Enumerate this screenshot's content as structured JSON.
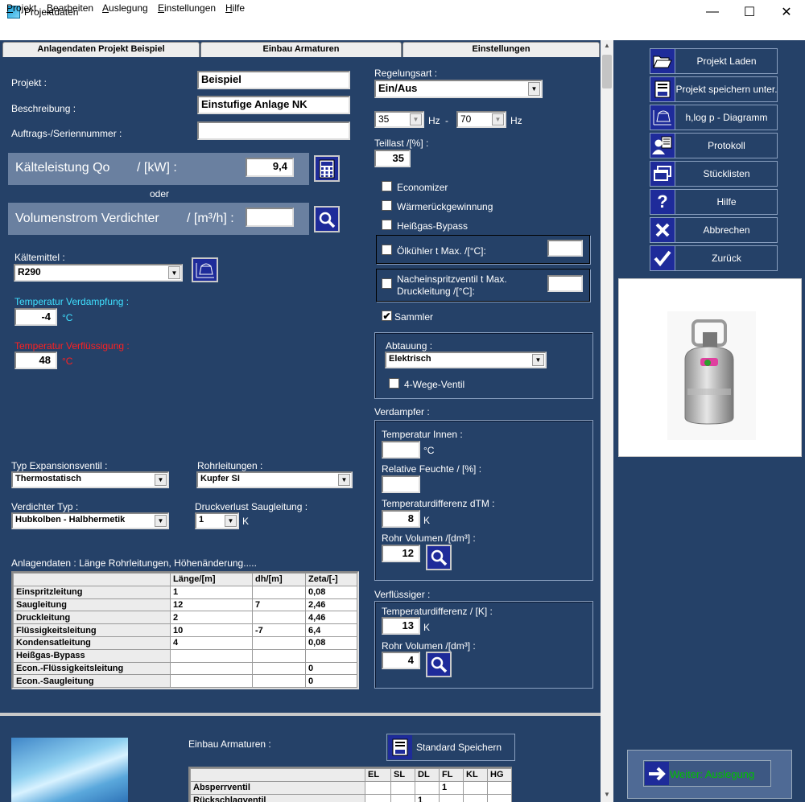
{
  "window": {
    "title": "Projektdaten",
    "minimize": "—",
    "maximize": "☐",
    "close": "✕"
  },
  "menu": [
    {
      "pre": "",
      "u": "P",
      "post": "rojekt"
    },
    {
      "pre": "",
      "u": "B",
      "post": "earbeiten"
    },
    {
      "pre": "",
      "u": "A",
      "post": "uslegung"
    },
    {
      "pre": "",
      "u": "E",
      "post": "instellungen"
    },
    {
      "pre": "",
      "u": "H",
      "post": "ilfe"
    }
  ],
  "tabs": [
    "Anlagendaten Projekt Beispiel",
    "Einbau Armaturen",
    "Einstellungen"
  ],
  "project": {
    "projekt_label": "Projekt :",
    "projekt_value": "Beispiel",
    "beschreibung_label": "Beschreibung :",
    "beschreibung_value": "Einstufige Anlage NK",
    "auftrag_label": "Auftrags-/Seriennummer :",
    "auftrag_value": ""
  },
  "capacity": {
    "label": "Kälteleistung Qo",
    "unit": "/ [kW] :",
    "value": "9,4",
    "oder": "oder",
    "vol_label": "Volumenstrom Verdichter",
    "vol_unit": "/ [m³/h] :",
    "vol_value": ""
  },
  "refrigerant": {
    "label": "Kältemittel :",
    "value": "R290"
  },
  "temps": {
    "evap_label": "Temperatur Verdampfung :",
    "evap_value": "-4",
    "evap_unit": "°C",
    "cond_label": "Temperatur Verflüssigung :",
    "cond_value": "48",
    "cond_unit": "°C"
  },
  "expansion": {
    "label": "Typ Expansionsventil :",
    "value": "Thermostatisch"
  },
  "pipes": {
    "label": "Rohrleitungen :",
    "value": "Kupfer SI"
  },
  "compressor": {
    "label": "Verdichter Typ :",
    "value": "Hubkolben - Halbhermetik"
  },
  "pressure_loss": {
    "label": "Druckverlust Saugleitung :",
    "value": "1",
    "unit": "K"
  },
  "plant_table": {
    "caption": "Anlagendaten : Länge Rohrleitungen, Höhenänderung.....",
    "headers": [
      "",
      "Länge/[m]",
      "dh/[m]",
      "Zeta/[-]"
    ],
    "rows": [
      [
        "Einspritzleitung",
        "1",
        "",
        "0,08"
      ],
      [
        "Saugleitung",
        "12",
        "7",
        "2,46"
      ],
      [
        "Druckleitung",
        "2",
        "",
        "4,46"
      ],
      [
        "Flüssigkeitsleitung",
        "10",
        "-7",
        "6,4"
      ],
      [
        "Kondensatleitung",
        "4",
        "",
        "0,08"
      ],
      [
        "Heißgas-Bypass",
        "",
        "",
        ""
      ],
      [
        "Econ.-Flüssigkeitsleitung",
        "",
        "",
        "0"
      ],
      [
        "Econ.-Saugleitung",
        "",
        "",
        "0"
      ]
    ]
  },
  "control": {
    "label": "Regelungsart :",
    "value": "Ein/Aus",
    "hz_min": "35",
    "hz_max": "70",
    "hz": "Hz",
    "dash": "-",
    "teillast_label": "Teillast  /[%] :",
    "teillast_value": "35"
  },
  "options": {
    "economizer": "Economizer",
    "waerme": "Wärmerückgewinnung",
    "heissgas": "Heißgas-Bypass",
    "oelkuehler": "Ölkühler  t Max.  /[°C]:",
    "nachein1": "Nacheinspritzventil t Max.",
    "nachein2": "Druckleitung  /[°C]:",
    "sammler": "Sammler",
    "sammler_checked": "✔"
  },
  "defrost": {
    "label": "Abtauung :",
    "value": "Elektrisch",
    "fourway": "4-Wege-Ventil"
  },
  "evaporator": {
    "label": "Verdampfer :",
    "t_in_label": "Temperatur Innen :",
    "t_in_unit": "°C",
    "rh_label": "Relative Feuchte / [%] :",
    "dtm_label": "Temperaturdifferenz dTM :",
    "dtm_value": "8",
    "dtm_unit": "K",
    "vol_label": "Rohr Volumen /[dm³] :",
    "vol_value": "12"
  },
  "condenser": {
    "label": "Verflüssiger :",
    "dt_label": "Temperaturdifferenz / [K] :",
    "dt_value": "13",
    "dt_unit": "K",
    "vol_label": "Rohr Volumen /[dm³] :",
    "vol_value": "4"
  },
  "fittings": {
    "label": "Einbau Armaturen :",
    "save": "Standard Speichern",
    "headers": [
      "",
      "EL",
      "SL",
      "DL",
      "FL",
      "KL",
      "HG"
    ],
    "rows": [
      [
        "Absperrventil",
        "",
        "",
        "",
        "1",
        "",
        ""
      ],
      [
        "Rückschlagventil",
        "",
        "",
        "1",
        "",
        "",
        ""
      ]
    ]
  },
  "sidebar": [
    "Projekt Laden",
    "Projekt speichern unter.",
    "h,log p - Diagramm",
    "Protokoll",
    "Stücklisten",
    "Hilfe",
    "Abbrechen",
    "Zurück"
  ],
  "next": {
    "label": "Weiter: Auslegung"
  },
  "colors": {
    "panel": "#254168",
    "band": "#6a80a0",
    "icon_bg": "#1e2b9a",
    "evap": "#3fe0ff",
    "cond": "#ff2020",
    "next_text": "#00c000"
  }
}
